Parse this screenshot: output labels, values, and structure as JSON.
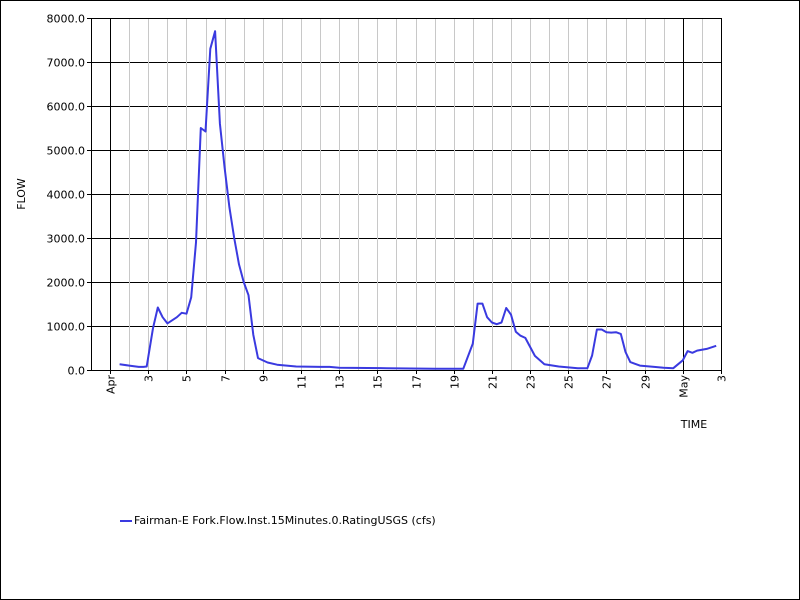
{
  "chart_data": {
    "type": "line",
    "xlabel": "TIME",
    "ylabel": "FLOW",
    "ylim": [
      0,
      8000
    ],
    "xlim": [
      "2012-03-31",
      "2012-05-03"
    ],
    "y_ticks": [
      "0.0",
      "1000.0",
      "2000.0",
      "3000.0",
      "4000.0",
      "5000.0",
      "6000.0",
      "7000.0",
      "8000.0"
    ],
    "x_ticks": [
      "Apr",
      "3",
      "5",
      "7",
      "9",
      "11",
      "13",
      "15",
      "17",
      "19",
      "21",
      "23",
      "25",
      "27",
      "29",
      "May",
      "3"
    ],
    "grid": true,
    "legend_position": "bottom-left",
    "series": [
      {
        "name": "Fairman-E Fork.Flow.Inst.15Minutes.0.RatingUSGS (cfs)",
        "color": "#3a3ae0",
        "points": [
          [
            "2012-04-01T12:00",
            130
          ],
          [
            "2012-04-02T00:00",
            100
          ],
          [
            "2012-04-02T12:00",
            70
          ],
          [
            "2012-04-02T18:00",
            70
          ],
          [
            "2012-04-02T22:00",
            80
          ],
          [
            "2012-04-03T06:00",
            950
          ],
          [
            "2012-04-03T12:00",
            1420
          ],
          [
            "2012-04-03T18:00",
            1200
          ],
          [
            "2012-04-04T00:00",
            1060
          ],
          [
            "2012-04-04T12:00",
            1200
          ],
          [
            "2012-04-04T18:00",
            1300
          ],
          [
            "2012-04-05T00:00",
            1280
          ],
          [
            "2012-04-05T06:00",
            1650
          ],
          [
            "2012-04-05T12:00",
            2900
          ],
          [
            "2012-04-05T18:00",
            5500
          ],
          [
            "2012-04-06T00:00",
            5420
          ],
          [
            "2012-04-06T06:00",
            7300
          ],
          [
            "2012-04-06T12:00",
            7700
          ],
          [
            "2012-04-06T18:00",
            5600
          ],
          [
            "2012-04-07T00:00",
            4600
          ],
          [
            "2012-04-07T06:00",
            3700
          ],
          [
            "2012-04-07T12:00",
            3000
          ],
          [
            "2012-04-07T18:00",
            2400
          ],
          [
            "2012-04-08T00:00",
            2000
          ],
          [
            "2012-04-08T06:00",
            1700
          ],
          [
            "2012-04-08T12:00",
            800
          ],
          [
            "2012-04-08T18:00",
            270
          ],
          [
            "2012-04-09T06:00",
            170
          ],
          [
            "2012-04-09T18:00",
            120
          ],
          [
            "2012-04-10T06:00",
            100
          ],
          [
            "2012-04-10T18:00",
            80
          ],
          [
            "2012-04-12T00:00",
            70
          ],
          [
            "2012-04-12T12:00",
            70
          ],
          [
            "2012-04-13T00:00",
            50
          ],
          [
            "2012-04-15T12:00",
            40
          ],
          [
            "2012-04-18T00:00",
            30
          ],
          [
            "2012-04-19T12:00",
            30
          ],
          [
            "2012-04-20T00:00",
            600
          ],
          [
            "2012-04-20T06:00",
            1510
          ],
          [
            "2012-04-20T12:00",
            1510
          ],
          [
            "2012-04-20T18:00",
            1200
          ],
          [
            "2012-04-21T00:00",
            1080
          ],
          [
            "2012-04-21T06:00",
            1040
          ],
          [
            "2012-04-21T12:00",
            1080
          ],
          [
            "2012-04-21T18:00",
            1410
          ],
          [
            "2012-04-22T00:00",
            1260
          ],
          [
            "2012-04-22T06:00",
            870
          ],
          [
            "2012-04-22T12:00",
            780
          ],
          [
            "2012-04-22T18:00",
            730
          ],
          [
            "2012-04-23T06:00",
            320
          ],
          [
            "2012-04-23T18:00",
            130
          ],
          [
            "2012-04-24T12:00",
            80
          ],
          [
            "2012-04-25T00:00",
            60
          ],
          [
            "2012-04-25T12:00",
            40
          ],
          [
            "2012-04-26T00:00",
            40
          ],
          [
            "2012-04-26T06:00",
            330
          ],
          [
            "2012-04-26T12:00",
            920
          ],
          [
            "2012-04-26T18:00",
            920
          ],
          [
            "2012-04-27T00:00",
            860
          ],
          [
            "2012-04-27T06:00",
            850
          ],
          [
            "2012-04-27T12:00",
            860
          ],
          [
            "2012-04-27T18:00",
            820
          ],
          [
            "2012-04-28T00:00",
            410
          ],
          [
            "2012-04-28T06:00",
            180
          ],
          [
            "2012-04-28T18:00",
            100
          ],
          [
            "2012-04-29T12:00",
            70
          ],
          [
            "2012-04-30T00:00",
            50
          ],
          [
            "2012-04-30T12:00",
            40
          ],
          [
            "2012-05-01T00:00",
            220
          ],
          [
            "2012-05-01T06:00",
            430
          ],
          [
            "2012-05-01T12:00",
            390
          ],
          [
            "2012-05-01T18:00",
            440
          ],
          [
            "2012-05-02T06:00",
            480
          ],
          [
            "2012-05-02T18:00",
            550
          ]
        ]
      }
    ]
  }
}
